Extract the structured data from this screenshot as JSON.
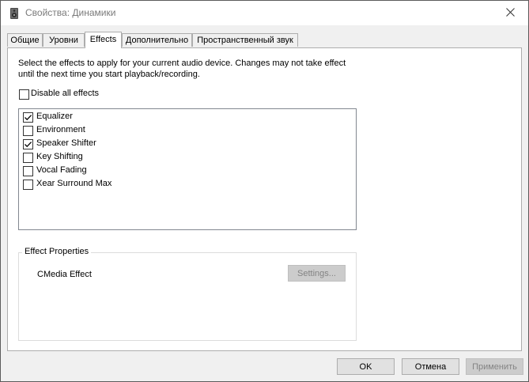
{
  "window": {
    "title": "Свойства: Динамики"
  },
  "tabs": [
    {
      "label": "Общие"
    },
    {
      "label": "Уровни"
    },
    {
      "label": "Effects"
    },
    {
      "label": "Дополнительно"
    },
    {
      "label": "Пространственный звук"
    }
  ],
  "effects": {
    "description": "Select the effects to apply for your current audio device. Changes may not take effect until the next time you start playback/recording.",
    "disable_all_label": "Disable all effects",
    "disable_all_checked": false,
    "items": [
      {
        "label": "Equalizer",
        "checked": true
      },
      {
        "label": "Environment",
        "checked": false
      },
      {
        "label": "Speaker Shifter",
        "checked": true
      },
      {
        "label": "Key Shifting",
        "checked": false
      },
      {
        "label": "Vocal Fading",
        "checked": false
      },
      {
        "label": "Xear Surround Max",
        "checked": false
      }
    ]
  },
  "properties": {
    "group_title": "Effect Properties",
    "effect_name": "CMedia Effect",
    "settings_label": "Settings..."
  },
  "footer": {
    "ok_label": "OK",
    "cancel_label": "Отмена",
    "apply_label": "Применить"
  }
}
